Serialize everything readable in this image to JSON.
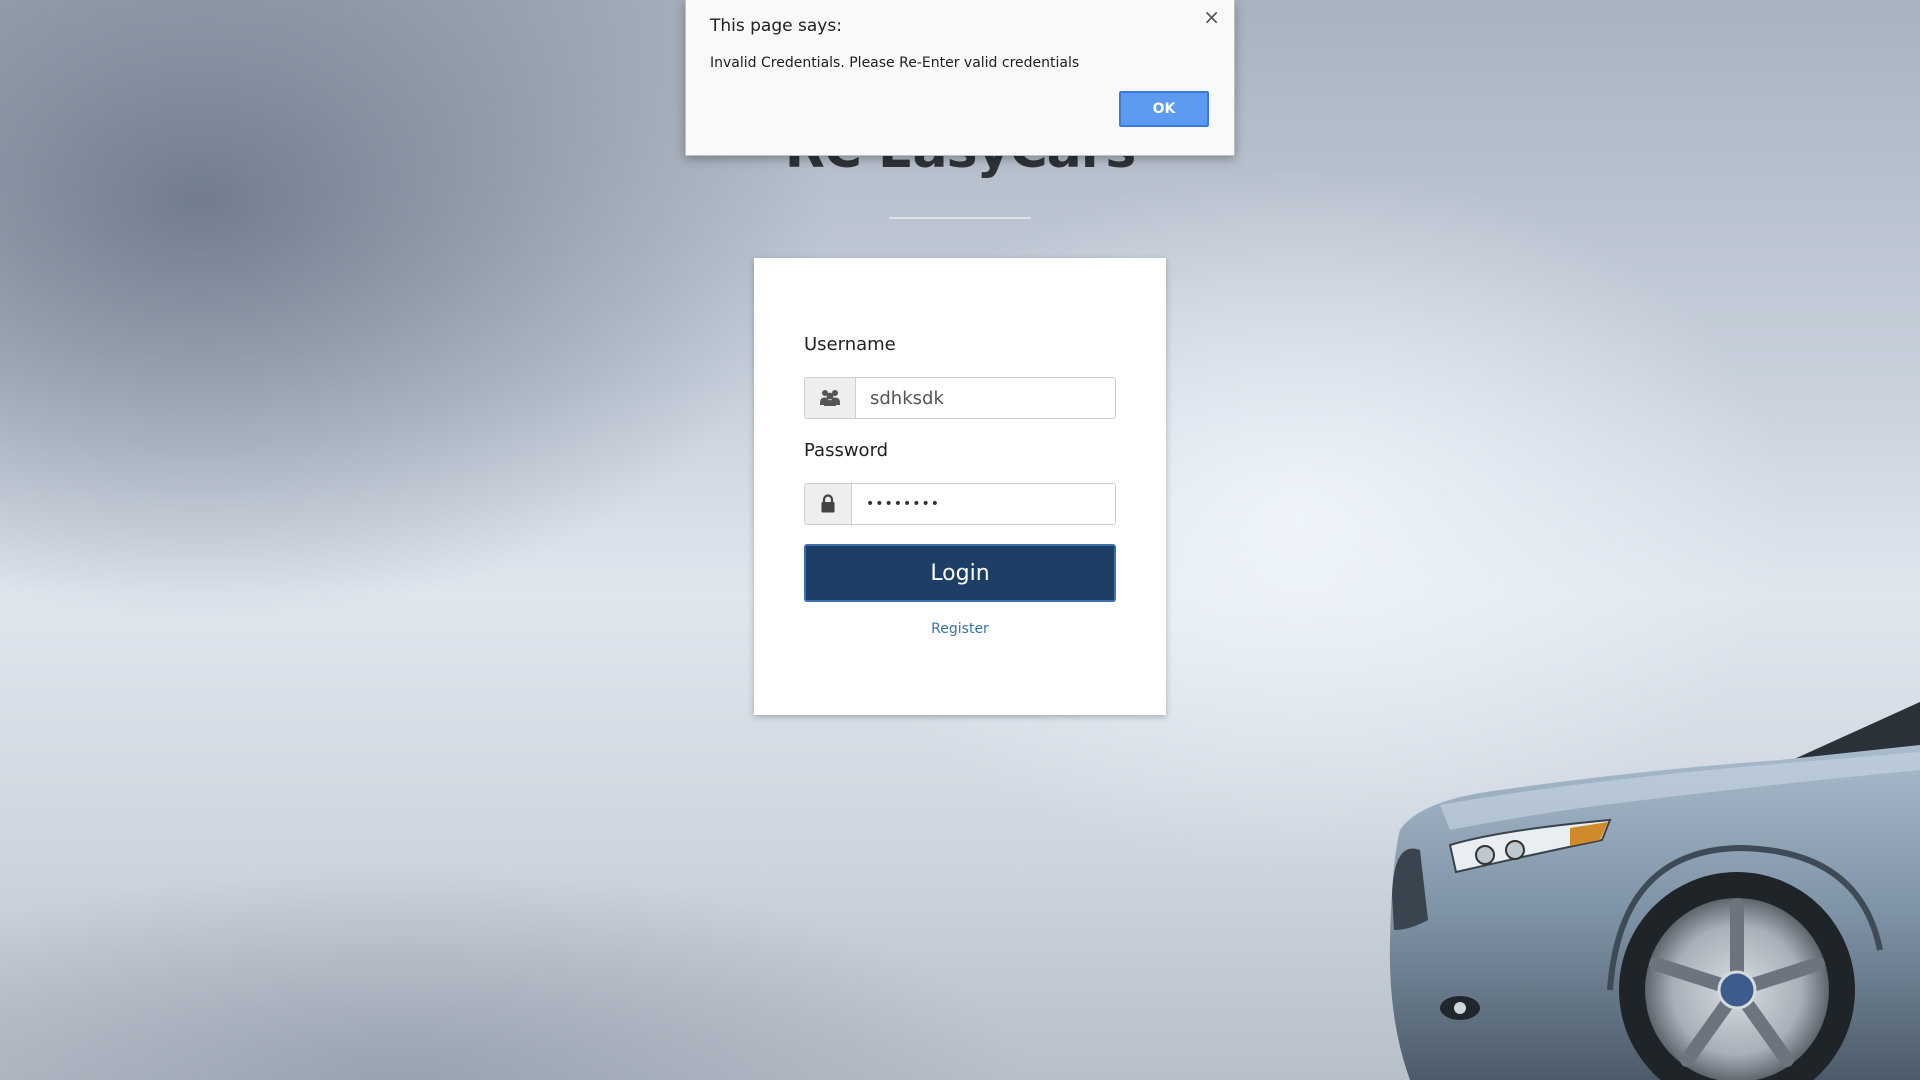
{
  "page": {
    "brand_title": "RC EasyCars"
  },
  "login": {
    "username_label": "Username",
    "username_value": "sdhksdk",
    "password_label": "Password",
    "password_value": "dsfsdfsd",
    "login_label": "Login",
    "register_label": "Register"
  },
  "icons": {
    "username": "users-icon",
    "password": "lock-icon"
  },
  "alert": {
    "title": "This page says:",
    "message": "Invalid Credentials. Please Re-Enter valid credentials",
    "ok_label": "OK",
    "close_glyph": "×"
  },
  "colors": {
    "login_button": "#1d3f66",
    "ok_button": "#5b9af0",
    "link": "#3a72a8"
  }
}
